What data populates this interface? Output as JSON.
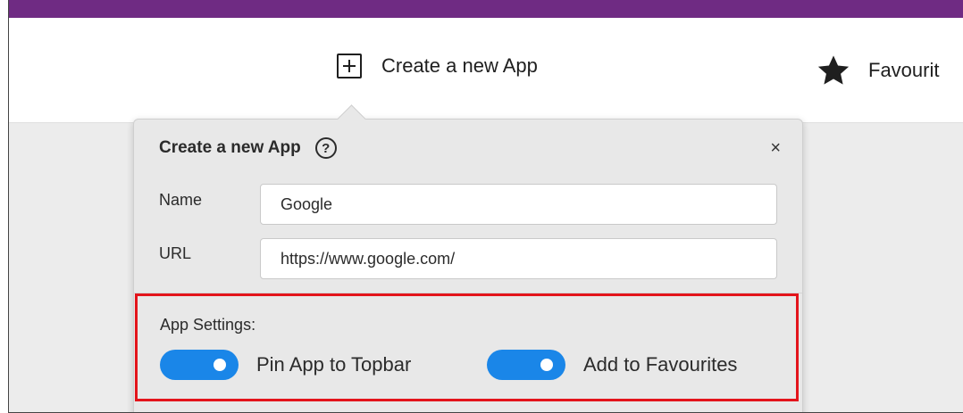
{
  "topbar": {
    "create_label": "Create a new App",
    "favourites_label": "Favourit"
  },
  "popup": {
    "title": "Create a new App",
    "help": "?",
    "close": "×",
    "name_label": "Name",
    "name_value": "Google",
    "url_label": "URL",
    "url_value": "https://www.google.com/",
    "settings_title": "App Settings:",
    "toggles": [
      {
        "label": "Pin App to Topbar",
        "on": true
      },
      {
        "label": "Add to Favourites",
        "on": true
      }
    ]
  },
  "colors": {
    "accent_strip": "#6f2b83",
    "toggle_on": "#1a86e8",
    "highlight_border": "#e3141b"
  },
  "icons": {
    "create": "plus-square-icon",
    "favourites": "star-icon",
    "help": "question-circle-icon",
    "close": "close-icon"
  }
}
